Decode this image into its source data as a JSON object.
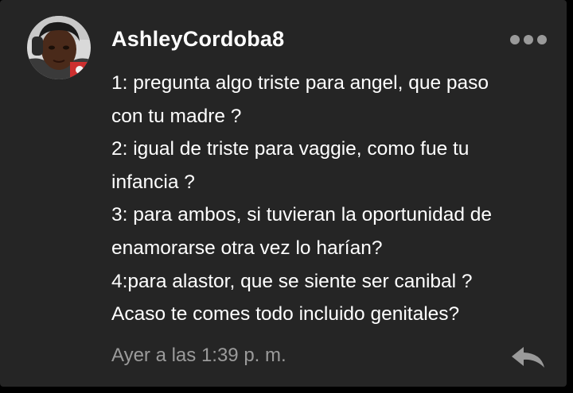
{
  "comment": {
    "username": "AshleyCordoba8",
    "avatar_icon": "user-avatar",
    "more_icon": "more-dots-icon",
    "lines": [
      "1: pregunta algo triste para angel, que paso",
      "con tu madre ?",
      "2: igual de triste para vaggie, como fue tu",
      "infancia ?",
      "3: para ambos, si tuvieran la oportunidad de",
      "enamorarse otra vez lo harían?",
      "4:para alastor, que se siente ser canibal ?",
      "Acaso te comes todo incluido genitales?"
    ],
    "timestamp": "Ayer a las 1:39 p. m.",
    "reply_icon": "reply-arrow-icon"
  },
  "colors": {
    "background": "#252525",
    "text": "#ffffff",
    "muted": "#9b9b9b"
  }
}
